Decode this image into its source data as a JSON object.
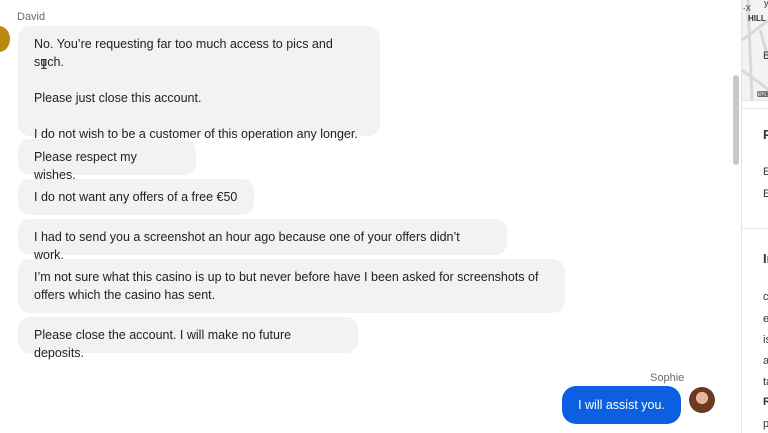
{
  "chat": {
    "customer_name": "David",
    "agent_name": "Sophie",
    "messages": [
      {
        "lines": [
          "No. You’re requesting far too much access to pics and such.",
          "",
          "Please just close this account.",
          "",
          "I do not wish to be a customer of this operation any longer."
        ]
      },
      {
        "lines": [
          "Please respect my wishes."
        ]
      },
      {
        "lines": [
          "I do not want any offers of a free €50"
        ]
      },
      {
        "lines": [
          "I had to send you a screenshot an hour ago because one of your offers didn’t work."
        ]
      },
      {
        "lines": [
          "I’m not sure what this casino is up to but never before have I been asked for screenshots of",
          "offers which the casino has sent."
        ]
      },
      {
        "lines": [
          "Please close the account. I will make no future deposits."
        ]
      }
    ],
    "agent_message": "I will assist you."
  },
  "side_panel": {
    "map_labels": [
      "-X",
      "HILL",
      "y"
    ],
    "items": [
      "B",
      "P",
      "E",
      "E",
      "Ir",
      "c",
      "e",
      "is",
      "a",
      "ta",
      "R",
      "p"
    ]
  },
  "colors": {
    "agent_bubble": "#0b5fe0",
    "customer_bubble": "#f2f2f3"
  }
}
